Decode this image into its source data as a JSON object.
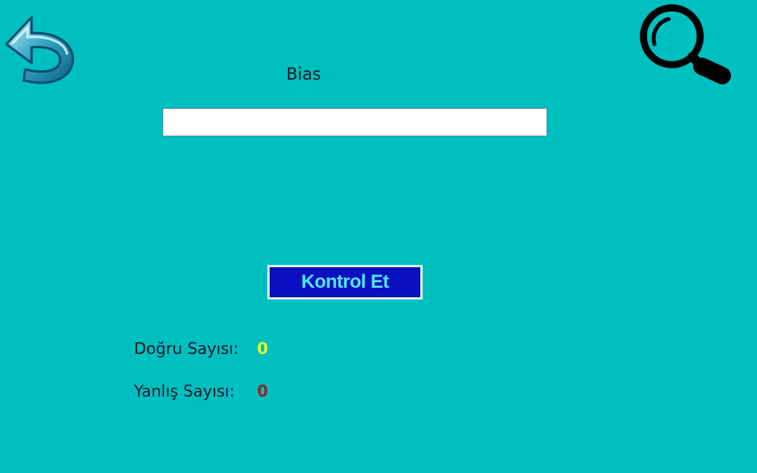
{
  "icons": {
    "back": "undo-arrow-icon",
    "search": "magnifier-icon"
  },
  "question": {
    "word": "Bias"
  },
  "answer_input": {
    "value": "",
    "placeholder": ""
  },
  "check_button": {
    "label": "Kontrol Et"
  },
  "stats": {
    "correct_label": "Doğru Sayısı:",
    "correct_value": "0",
    "wrong_label": "Yanlış Sayısı:",
    "wrong_value": "0"
  },
  "colors": {
    "background": "#00bfbf",
    "button_background": "#0a10c0",
    "button_text": "#4fe8ff",
    "correct_value": "#d6ff3a",
    "wrong_value": "#8b2a1f"
  }
}
